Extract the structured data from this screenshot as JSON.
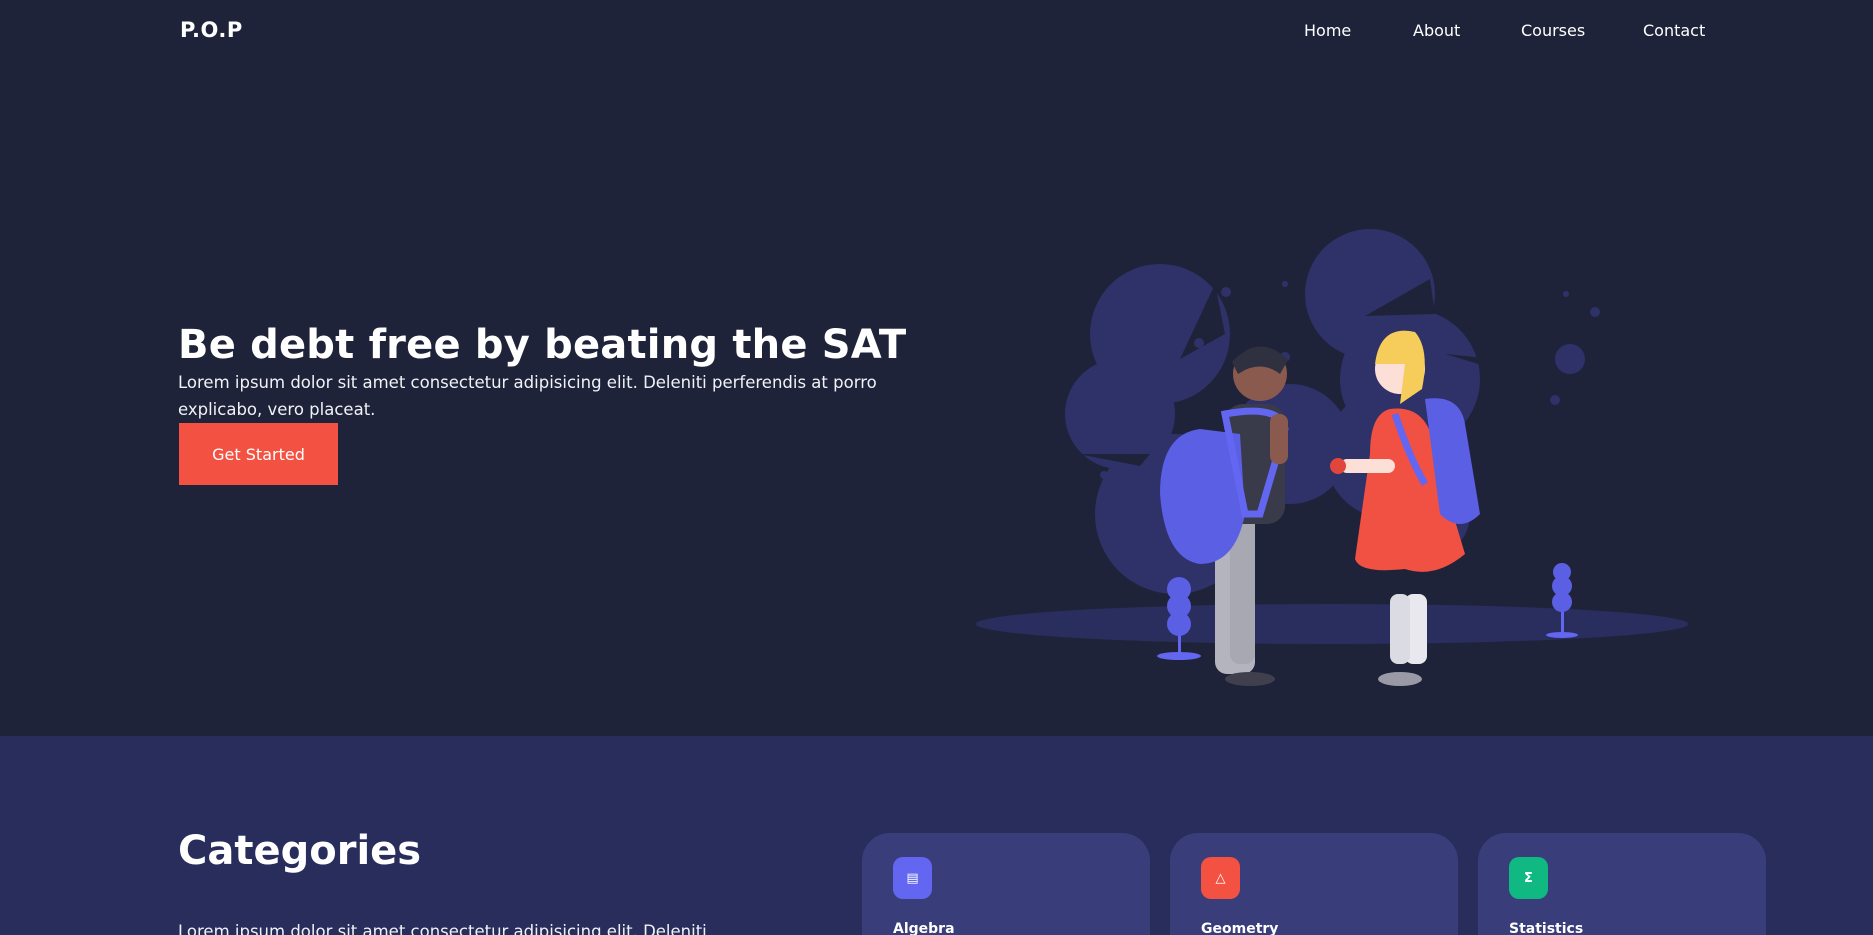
{
  "header": {
    "logo": "P.O.P",
    "nav": [
      "Home",
      "About",
      "Courses",
      "Contact"
    ]
  },
  "hero": {
    "title": "Be debt free by beating the SAT",
    "text": "Lorem ipsum dolor sit amet consectetur adipisicing elit. Deleniti perferendis at porro explicabo, vero placeat.",
    "cta_label": "Get Started"
  },
  "categories": {
    "title": "Categories",
    "text": "Lorem ipsum dolor sit amet consectetur adipisicing elit. Deleniti",
    "cards": [
      {
        "name": "Algebra",
        "icon": "calculator-icon",
        "color": "#6366f1",
        "glyph": "▤"
      },
      {
        "name": "Geometry",
        "icon": "triangle-icon",
        "color": "#f35141",
        "glyph": "△"
      },
      {
        "name": "Statistics",
        "icon": "sigma-icon",
        "color": "#10b981",
        "glyph": "Σ"
      }
    ]
  },
  "colors": {
    "background": "#1f2339",
    "section": "#292d5c",
    "card": "#393e7a",
    "accent": "#f35141"
  }
}
